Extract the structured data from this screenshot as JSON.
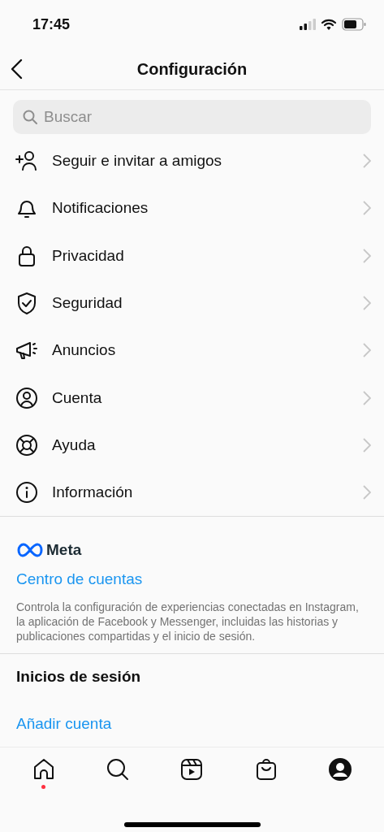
{
  "status_bar": {
    "time": "17:45"
  },
  "header": {
    "title": "Configuración"
  },
  "search": {
    "placeholder": "Buscar"
  },
  "menu_items": [
    {
      "kind": "follow",
      "label": "Seguir e invitar a amigos"
    },
    {
      "kind": "bell",
      "label": "Notificaciones"
    },
    {
      "kind": "lock",
      "label": "Privacidad"
    },
    {
      "kind": "shield",
      "label": "Seguridad"
    },
    {
      "kind": "megaphone",
      "label": "Anuncios"
    },
    {
      "kind": "account",
      "label": "Cuenta"
    },
    {
      "kind": "help",
      "label": "Ayuda"
    },
    {
      "kind": "info",
      "label": "Información"
    }
  ],
  "meta_section": {
    "brand": "Meta",
    "link": "Centro de cuentas",
    "description": "Controla la configuración de experiencias conectadas en Instagram, la aplicación de Facebook y Messenger, incluidas las historias y publicaciones compartidas y el inicio de sesión."
  },
  "logins_section": {
    "title": "Inicios de sesión",
    "link": "Añadir cuenta"
  },
  "tab_bar": [
    {
      "kind": "home",
      "selected": false,
      "dot": true
    },
    {
      "kind": "search",
      "selected": false,
      "dot": false
    },
    {
      "kind": "reels",
      "selected": false,
      "dot": false
    },
    {
      "kind": "shop",
      "selected": false,
      "dot": false
    },
    {
      "kind": "profile",
      "selected": true,
      "dot": false
    }
  ]
}
